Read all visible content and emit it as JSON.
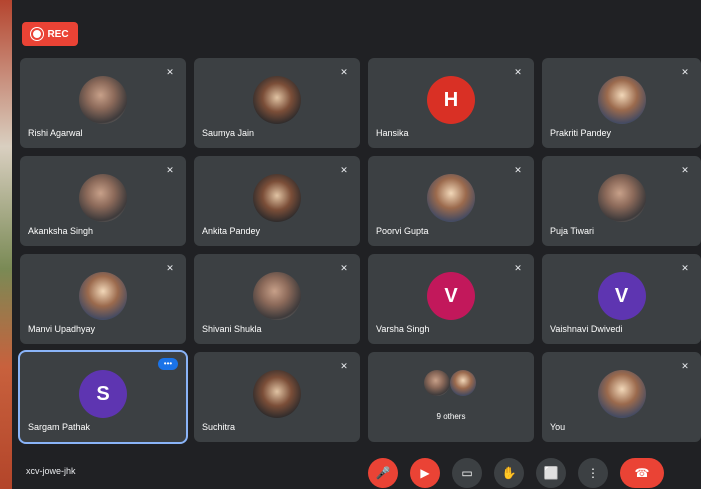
{
  "recording_badge": {
    "label": "REC"
  },
  "participants": [
    {
      "name": "Rishi Agarwal",
      "avatar": "photo"
    },
    {
      "name": "Saumya Jain",
      "avatar": "photo"
    },
    {
      "name": "Hansika",
      "avatar": "initial",
      "initial": "H",
      "color": "#d93025"
    },
    {
      "name": "Prakriti Pandey",
      "avatar": "photo"
    },
    {
      "name": "Akanksha Singh",
      "avatar": "photo"
    },
    {
      "name": "Ankita Pandey",
      "avatar": "photo"
    },
    {
      "name": "Poorvi Gupta",
      "avatar": "photo"
    },
    {
      "name": "Puja Tiwari",
      "avatar": "photo"
    },
    {
      "name": "Manvi Upadhyay",
      "avatar": "photo"
    },
    {
      "name": "Shivani Shukla",
      "avatar": "photo"
    },
    {
      "name": "Varsha Singh",
      "avatar": "initial",
      "initial": "V",
      "color": "#c2185b"
    },
    {
      "name": "Vaishnavi Dwivedi",
      "avatar": "initial",
      "initial": "V",
      "color": "#5e35b1"
    },
    {
      "name": "Sargam Pathak",
      "avatar": "initial",
      "initial": "S",
      "color": "#5e35b1"
    },
    {
      "name": "Suchitra",
      "avatar": "photo"
    },
    {
      "name": "9 others",
      "avatar": "group"
    },
    {
      "name": "You",
      "avatar": "photo"
    }
  ],
  "meeting": {
    "code": "xcv-jowe-jhk"
  },
  "controls": {
    "mic_icon": "mic-off-icon",
    "camera_icon": "camera-off-icon",
    "captions_icon": "captions-icon",
    "raise_hand_icon": "hand-icon",
    "present_icon": "present-icon",
    "more_icon": "more-vert-icon",
    "end_call_icon": "call-end-icon"
  }
}
